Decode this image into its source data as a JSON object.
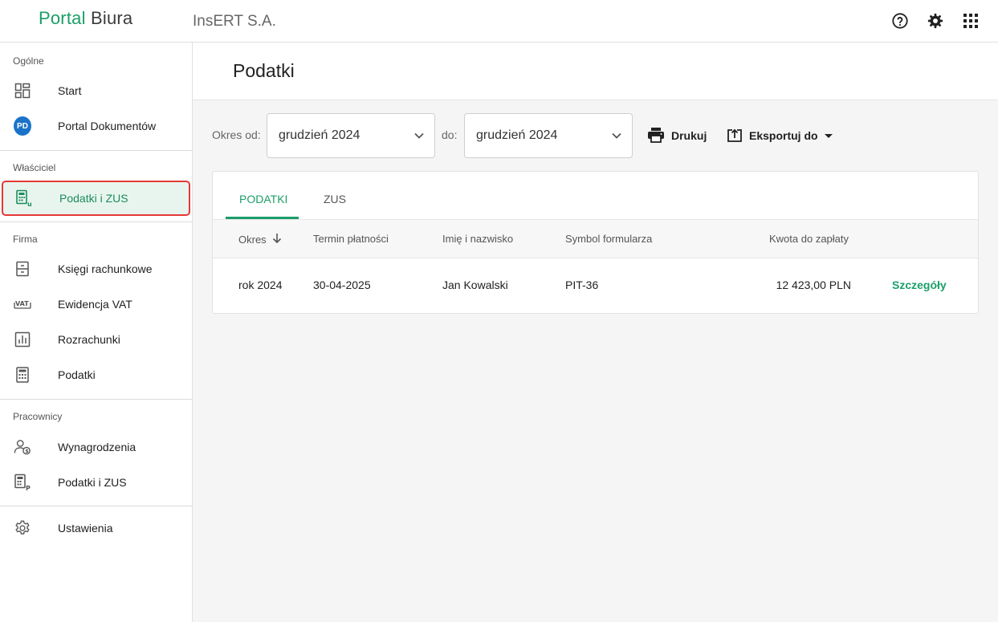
{
  "topbar": {
    "logo_part1": "Portal",
    "logo_part2": "Biura",
    "company": "InsERT S.A.",
    "icons": [
      "help-icon",
      "settings-gear-icon",
      "apps-grid-icon"
    ]
  },
  "sidebar": {
    "sections": [
      {
        "label": "Ogólne",
        "items": [
          {
            "label": "Start",
            "icon": "dashboard-icon"
          },
          {
            "label": "Portal Dokumentów",
            "icon": "pd-badge-icon",
            "badge": "PD"
          }
        ]
      },
      {
        "label": "Właściciel",
        "items": [
          {
            "label": "Podatki i ZUS",
            "icon": "calculator-u-icon",
            "active": true
          }
        ]
      },
      {
        "label": "Firma",
        "items": [
          {
            "label": "Księgi rachunkowe",
            "icon": "ledger-icon"
          },
          {
            "label": "Ewidencja VAT",
            "icon": "vat-icon"
          },
          {
            "label": "Rozrachunki",
            "icon": "bar-chart-icon"
          },
          {
            "label": "Podatki",
            "icon": "calculator-icon"
          }
        ]
      },
      {
        "label": "Pracownicy",
        "items": [
          {
            "label": "Wynagrodzenia",
            "icon": "person-money-icon"
          },
          {
            "label": "Podatki i ZUS",
            "icon": "calculator-p-icon"
          }
        ]
      },
      {
        "label": "",
        "items": [
          {
            "label": "Ustawienia",
            "icon": "gear-icon"
          }
        ]
      }
    ]
  },
  "main": {
    "title": "Podatki",
    "filters": {
      "from_label": "Okres od:",
      "from_value": "grudzień 2024",
      "to_label": "do:",
      "to_value": "grudzień 2024"
    },
    "actions": {
      "print": "Drukuj",
      "export": "Eksportuj do"
    },
    "tabs": [
      {
        "label": "PODATKI",
        "active": true
      },
      {
        "label": "ZUS",
        "active": false
      }
    ],
    "table": {
      "columns": [
        "Okres",
        "Termin płatności",
        "Imię i nazwisko",
        "Symbol formularza",
        "Kwota do zapłaty"
      ],
      "sort_column": "Okres",
      "rows": [
        {
          "okres": "rok 2024",
          "termin": "30-04-2025",
          "osoba": "Jan Kowalski",
          "symbol": "PIT-36",
          "kwota": "12 423,00 PLN",
          "link": "Szczegóły"
        }
      ]
    }
  },
  "colors": {
    "brand": "#1b9e6a",
    "active_bg": "#e8f5ee",
    "highlight_border": "#e53935",
    "pd_badge": "#1a73c8"
  }
}
